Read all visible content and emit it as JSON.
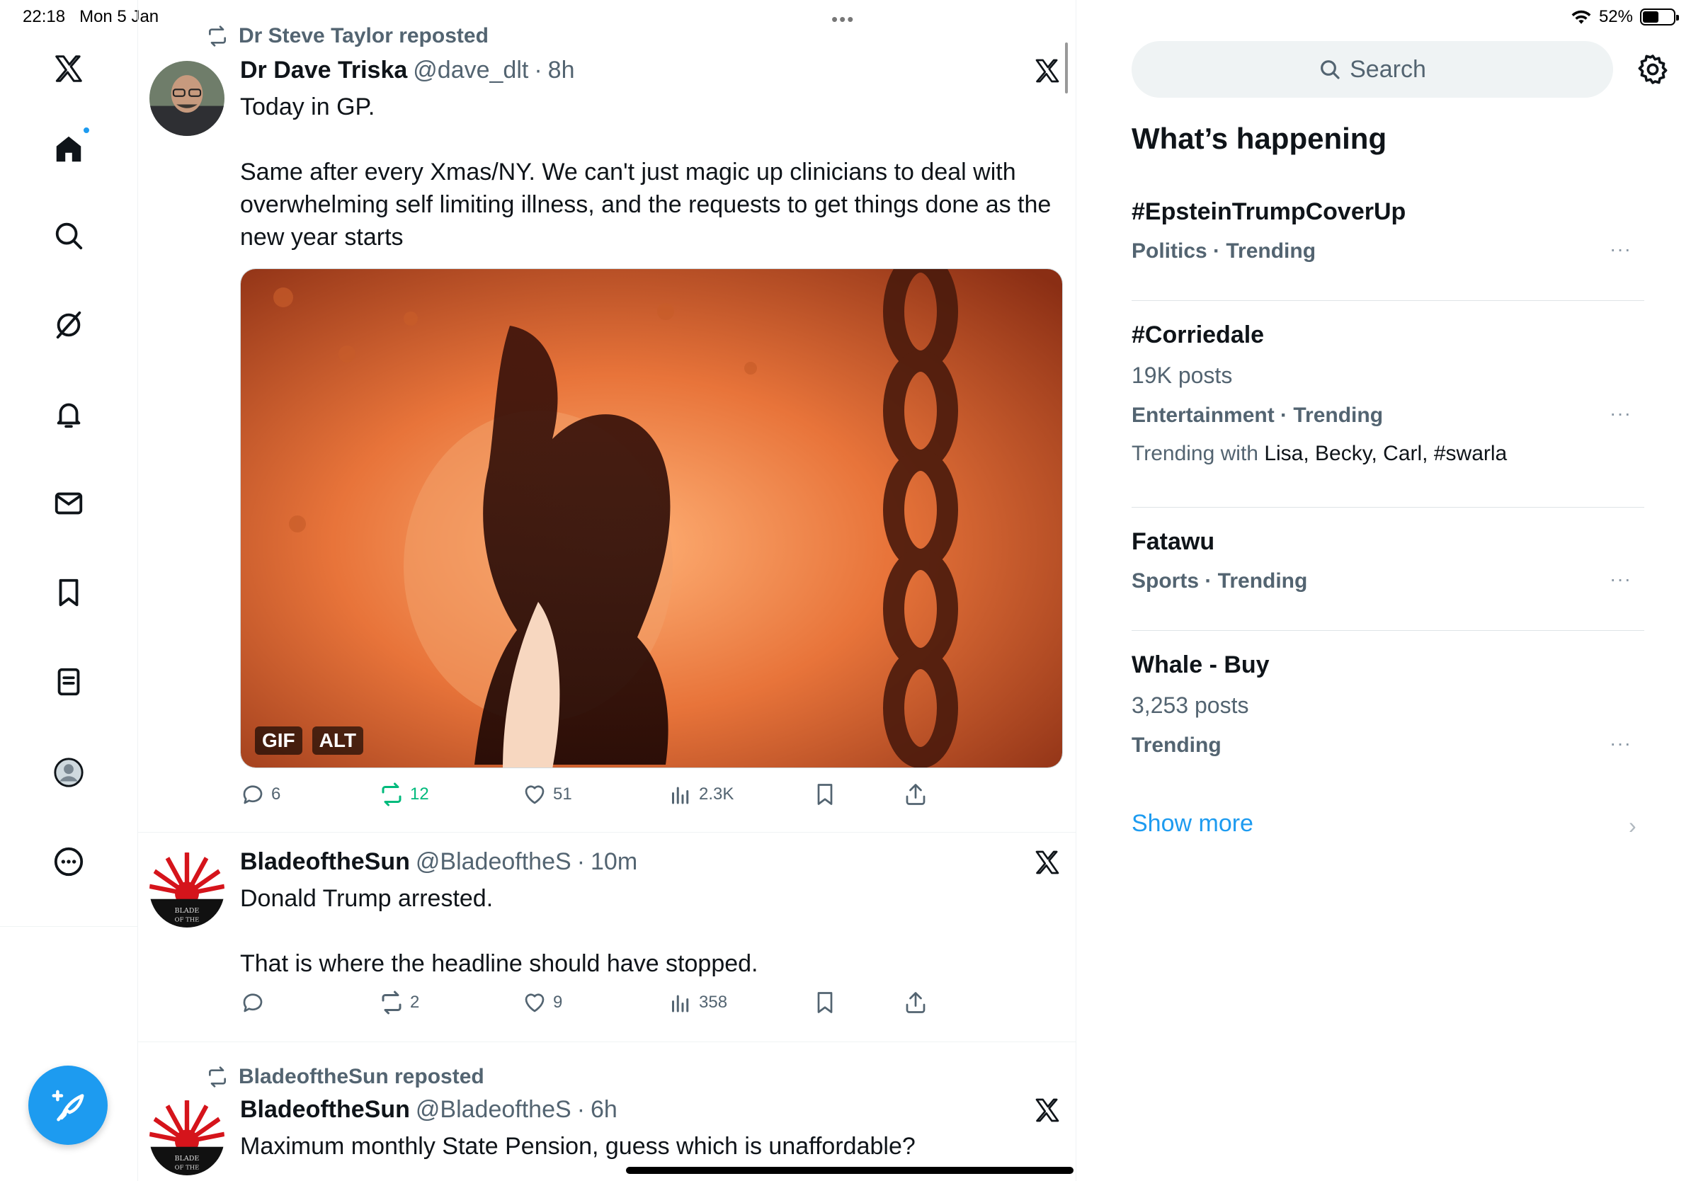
{
  "status_bar": {
    "time": "22:18",
    "date": "Mon 5 Jan",
    "battery": "52%",
    "battery_level": 0.52
  },
  "nav": {
    "items": [
      "x-logo",
      "home",
      "search",
      "grok",
      "notifications",
      "messages",
      "bookmarks",
      "lists",
      "profile",
      "more"
    ],
    "compose_icon": "compose-feather-icon"
  },
  "timeline": {
    "tweets": [
      {
        "repost_by": "Dr Steve Taylor reposted",
        "name": "Dr Dave Triska",
        "handle": "@dave_dlt",
        "sep": "·",
        "time": "8h",
        "text": "Today in GP.\n\nSame after every Xmas/NY. We can't just magic up clinicians to deal with overwhelming self limiting illness, and the requests to get things done as the new year starts",
        "media": {
          "badge_gif": "GIF",
          "badge_alt": "ALT"
        },
        "replies": "6",
        "reposts": "12",
        "likes": "51",
        "views": "2.3K"
      },
      {
        "name": "BladeoftheSun",
        "handle": "@BladeoftheS",
        "sep": "·",
        "time": "10m",
        "text": "Donald Trump arrested.\n\nThat is where the headline should have stopped.",
        "replies": "",
        "reposts": "2",
        "likes": "9",
        "views": "358"
      },
      {
        "repost_by": "BladeoftheSun reposted",
        "name": "BladeoftheSun",
        "handle": "@BladeoftheS",
        "sep": "·",
        "time": "6h",
        "text": "Maximum monthly State Pension, guess which is unaffordable?"
      }
    ]
  },
  "sidebar": {
    "search_placeholder": "Search",
    "section_title": "What’s happening",
    "trends": [
      {
        "name": "#EpsteinTrumpCoverUp",
        "meta": "Politics · Trending"
      },
      {
        "name": "#Corriedale",
        "count": "19K posts",
        "meta": "Entertainment · Trending",
        "with_label": "Trending with",
        "with_names": "Lisa, Becky, Carl, #swarla"
      },
      {
        "name": "Fatawu",
        "meta": "Sports · Trending"
      },
      {
        "name": "Whale - Buy",
        "count": "3,253 posts",
        "meta": "Trending"
      }
    ],
    "more_dots": "···",
    "show_more": "Show more",
    "chevron": "›"
  },
  "colors": {
    "accent": "#1d9bf0",
    "repost_green": "#00ba7c",
    "secondary_text": "#536471"
  }
}
